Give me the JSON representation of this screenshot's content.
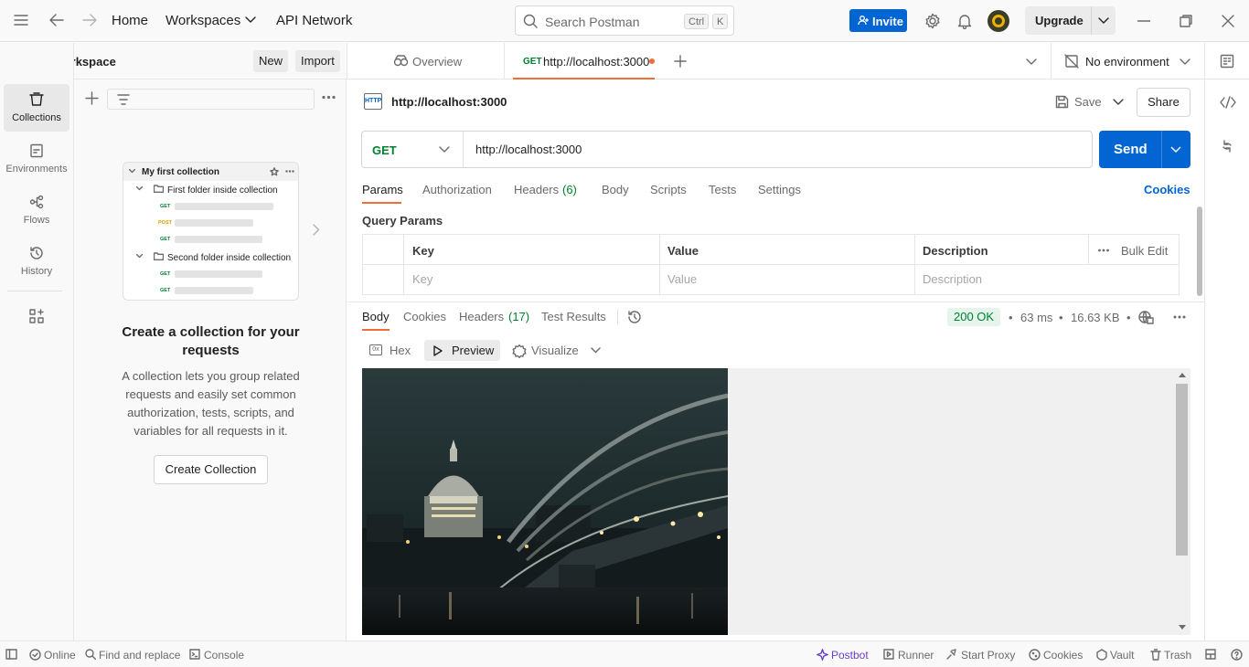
{
  "topbar": {
    "home": "Home",
    "workspaces": "Workspaces",
    "api_network": "API Network",
    "search_placeholder": "Search Postman",
    "kbd_ctrl": "Ctrl",
    "kbd_k": "K",
    "invite": "Invite",
    "upgrade": "Upgrade"
  },
  "workspace": {
    "name": "My Workspace",
    "new": "New",
    "import": "Import"
  },
  "leftnav": [
    {
      "label": "Collections",
      "icon": "collections-icon"
    },
    {
      "label": "Environments",
      "icon": "environments-icon"
    },
    {
      "label": "Flows",
      "icon": "flows-icon"
    },
    {
      "label": "History",
      "icon": "history-icon"
    }
  ],
  "illustration": {
    "collection": "My first collection",
    "folder1": "First folder inside collection",
    "folder2": "Second folder inside collection",
    "methods": [
      "GET",
      "POST",
      "GET",
      "GET",
      "GET"
    ]
  },
  "empty_state": {
    "title": "Create a collection for your requests",
    "description": "A collection lets you group related requests and easily set common authorization, tests, scripts, and variables for all requests in it.",
    "button": "Create Collection"
  },
  "tabs": {
    "overview": "Overview",
    "active_method": "GET",
    "active_url": "http://localhost:3000",
    "environment": "No environment"
  },
  "request": {
    "name": "http://localhost:3000",
    "save": "Save",
    "share": "Share",
    "method": "GET",
    "url": "http://localhost:3000",
    "send": "Send",
    "tabs": [
      "Params",
      "Authorization",
      "Headers",
      "Body",
      "Scripts",
      "Tests",
      "Settings"
    ],
    "headers_count": "(6)",
    "cookies": "Cookies",
    "query_params_title": "Query Params",
    "columns": [
      "Key",
      "Value",
      "Description"
    ],
    "bulk_edit": "Bulk Edit",
    "placeholders": [
      "Key",
      "Value",
      "Description"
    ]
  },
  "response": {
    "tabs": [
      "Body",
      "Cookies",
      "Headers",
      "Test Results"
    ],
    "headers_count": "(17)",
    "status": "200 OK",
    "time": "63 ms",
    "size": "16.63 KB",
    "views": [
      "Hex",
      "Preview",
      "Visualize"
    ]
  },
  "statusbar": {
    "online": "Online",
    "find_replace": "Find and replace",
    "console": "Console",
    "postbot": "Postbot",
    "runner": "Runner",
    "start_proxy": "Start Proxy",
    "cookies": "Cookies",
    "vault": "Vault",
    "trash": "Trash"
  },
  "colors": {
    "accent_blue": "#0265d2",
    "tab_underline": "#f26b3a",
    "status_ok": "#007f31",
    "postbot": "#6b3fc8"
  }
}
